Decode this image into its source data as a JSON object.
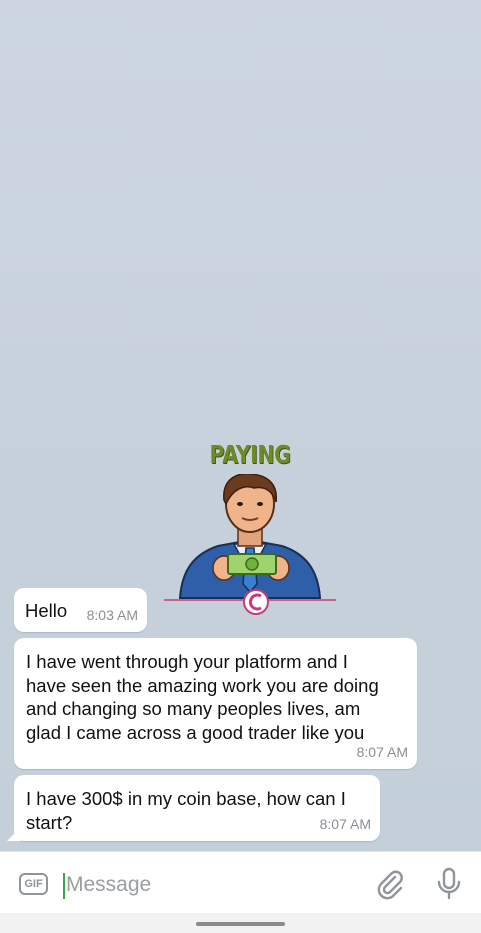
{
  "sticker": {
    "caption": "PAYING",
    "icon": "businessman-holding-cash-sticker",
    "caption_color": "#6c8b26"
  },
  "messages": [
    {
      "text": "Hello",
      "time": "8:03 AM"
    },
    {
      "text": "I have went through your platform and I\nhave seen the amazing work you are doing\nand changing so many peoples lives, am\nglad I came across a good trader like you",
      "time": "8:07 AM"
    },
    {
      "text": "I have 300$ in my coin base, how can I\nstart?",
      "time": "8:07 AM"
    }
  ],
  "input_bar": {
    "gif_label": "GIF",
    "placeholder": "Message",
    "value": "",
    "attach_icon": "paperclip-icon",
    "mic_icon": "microphone-icon"
  },
  "colors": {
    "chat_background": "#c9d3de",
    "bubble": "#ffffff",
    "time_text": "#8a8f95",
    "caret": "#3aa34f"
  }
}
